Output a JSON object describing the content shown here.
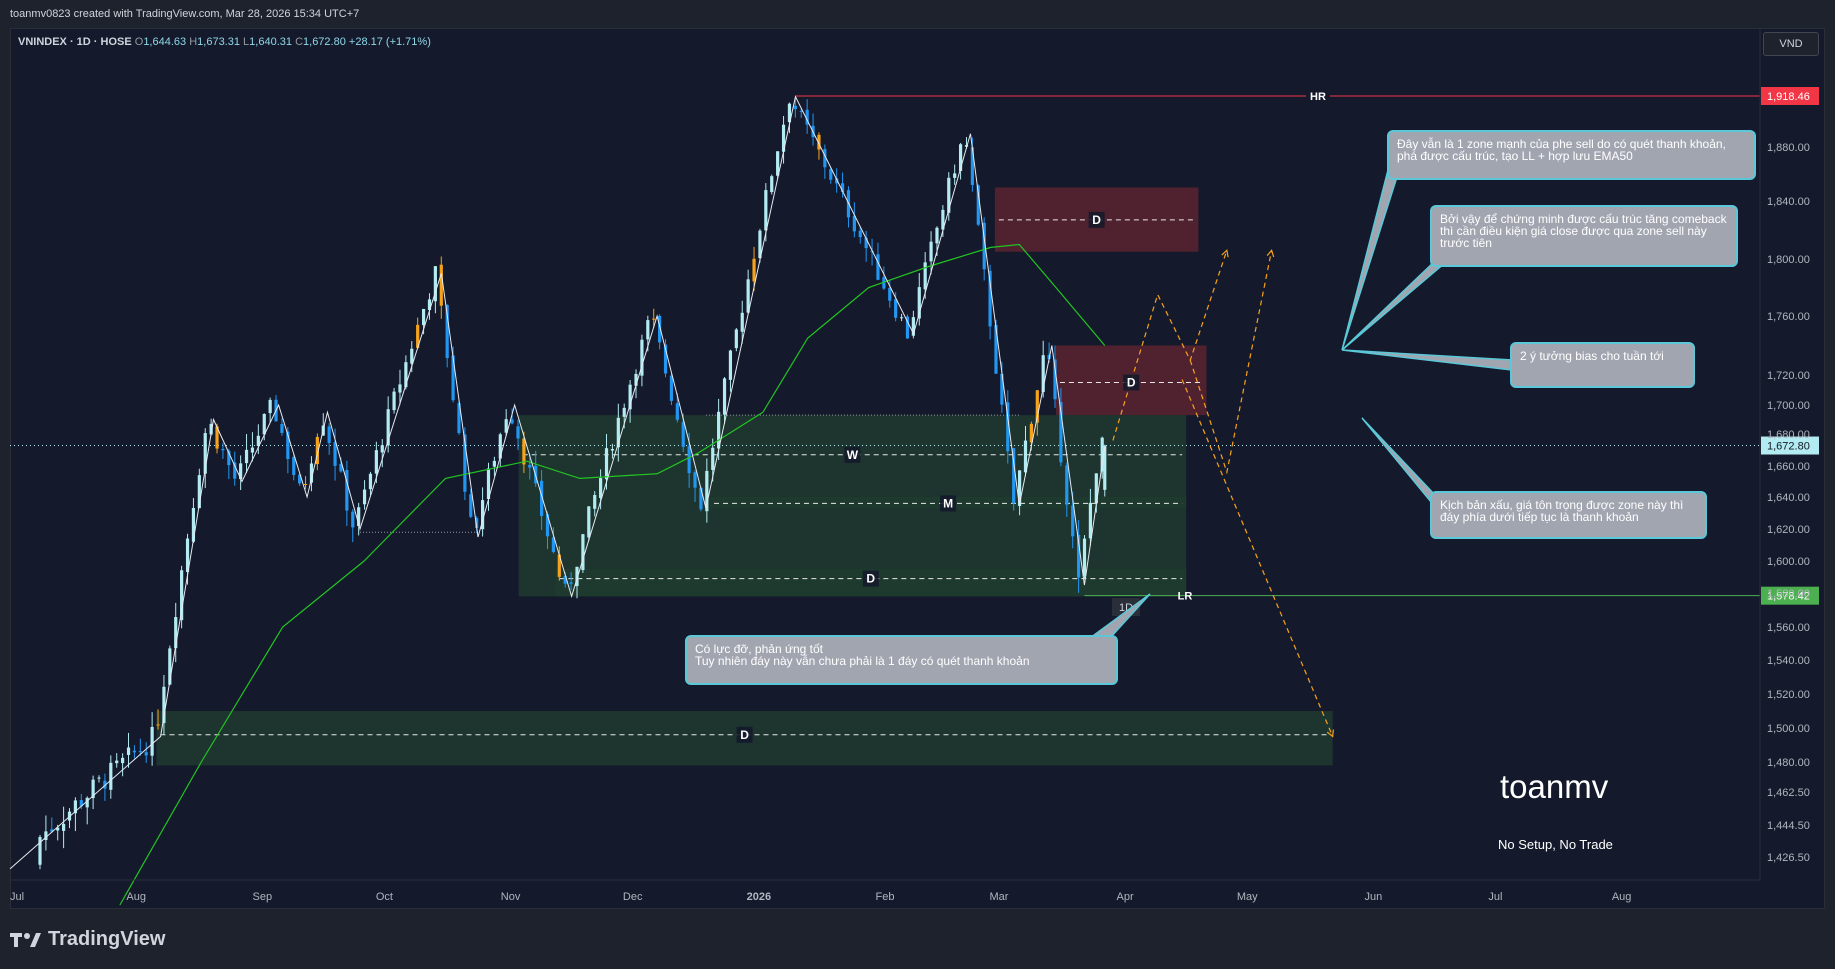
{
  "header": {
    "credit": "toanmv0823 created with TradingView.com, Mar 28, 2026 15:34 UTC+7"
  },
  "legend": {
    "symbol": "VNINDEX · 1D · HOSE",
    "o_label": "O",
    "o": "1,644.63",
    "h_label": "H",
    "h": "1,673.31",
    "l_label": "L",
    "l": "1,640.31",
    "c_label": "C",
    "c": "1,672.80",
    "change": "+28.17 (+1.71%)"
  },
  "currency_button": "VND",
  "branding": {
    "name": "TradingView"
  },
  "watermark": {
    "name": "toanmv",
    "tagline": "No Setup, No Trade"
  },
  "colors": {
    "background": "#141a2b",
    "candle_up": "#b2ebf2",
    "candle_down": "#2196f3",
    "candle_inside": "#f7a21b",
    "ema": "#22c522",
    "supply_zone": "#5a2330",
    "demand_zone": "#1f3b2f",
    "hr_line": "#f23645",
    "lr_line": "#4caf50",
    "callout_bg": "#a1a5b0",
    "callout_border": "#5ac8d8",
    "projection": "#f7a21b"
  },
  "annotations": {
    "hr_label": "HR",
    "lr_label": "LR",
    "tf_badge": "1D",
    "zone_d": "D",
    "zone_w": "W",
    "zone_m": "M",
    "callout_support": "Có lực đỡ, phản ứng tốt\nTuy nhiên đáy này vẫn chưa phải là 1 đáy có quét thanh khoản",
    "callout_sell_zone": "Đây vẫn là 1 zone mạnh của phe sell do có quét thanh khoản, phá được cấu trúc, tạo LL + hợp lưu EMA50",
    "callout_structure": "Bởi vậy để chứng minh được cấu trúc tăng comeback thì cần điều kiện giá close được qua zone sell này trước tiên",
    "callout_bias": "2 ý tưởng bias cho tuần tới",
    "callout_bearish": "Kịch bản xấu, giá tôn trọng được zone này thì đáy phía dưới tiếp tục là thanh khoản"
  },
  "chart_data": {
    "type": "candlestick",
    "symbol": "VNINDEX",
    "timeframe": "1D",
    "exchange": "HOSE",
    "y_ticks": [
      "1,880.00",
      "1,840.00",
      "1,800.00",
      "1,760.00",
      "1,720.00",
      "1,700.00",
      "1,680.00",
      "1,660.00",
      "1,640.00",
      "1,620.00",
      "1,600.00",
      "1,580.00",
      "1,560.00",
      "1,540.00",
      "1,520.00",
      "1,500.00",
      "1,480.00",
      "1,462.50",
      "1,444.50",
      "1,426.50"
    ],
    "x_ticks": [
      "Jul",
      "Aug",
      "Sep",
      "Oct",
      "Nov",
      "Dec",
      "2026",
      "Feb",
      "Mar",
      "Apr",
      "May",
      "Jun",
      "Jul",
      "Aug"
    ],
    "last_price": "1,672.80",
    "price_labels": {
      "hr": "1,918.46",
      "lr": "1,578.42"
    },
    "swing_path": [
      [
        "2025-07-01",
        1420
      ],
      [
        "2025-08-07",
        1495
      ],
      [
        "2025-08-20",
        1690
      ],
      [
        "2025-08-27",
        1650
      ],
      [
        "2025-09-05",
        1700
      ],
      [
        "2025-09-12",
        1640
      ],
      [
        "2025-09-17",
        1695
      ],
      [
        "2025-09-25",
        1620
      ],
      [
        "2025-10-15",
        1790
      ],
      [
        "2025-10-24",
        1615
      ],
      [
        "2025-11-02",
        1700
      ],
      [
        "2025-11-16",
        1578
      ],
      [
        "2025-12-07",
        1760
      ],
      [
        "2025-12-19",
        1633
      ],
      [
        "2026-01-10",
        1918
      ],
      [
        "2026-02-08",
        1748
      ],
      [
        "2026-02-22",
        1890
      ],
      [
        "2026-03-06",
        1635
      ],
      [
        "2026-03-14",
        1740
      ],
      [
        "2026-03-22",
        1585
      ],
      [
        "2026-03-27",
        1672
      ]
    ],
    "ema50": [
      [
        "2025-07-28",
        1400
      ],
      [
        "2025-08-17",
        1480
      ],
      [
        "2025-09-06",
        1560
      ],
      [
        "2025-09-26",
        1600
      ],
      [
        "2025-10-16",
        1652
      ],
      [
        "2025-11-05",
        1663
      ],
      [
        "2025-11-18",
        1652
      ],
      [
        "2025-12-07",
        1655
      ],
      [
        "2025-12-17",
        1668
      ],
      [
        "2026-01-02",
        1695
      ],
      [
        "2026-01-13",
        1745
      ],
      [
        "2026-01-28",
        1780
      ],
      [
        "2026-02-12",
        1795
      ],
      [
        "2026-02-27",
        1808
      ],
      [
        "2026-03-06",
        1810
      ],
      [
        "2026-03-15",
        1780
      ],
      [
        "2026-03-27",
        1740
      ]
    ],
    "zones": [
      {
        "type": "supply",
        "label": "D",
        "start": "2026-02-28",
        "end": "2026-04-19",
        "top": 1850,
        "bottom": 1805,
        "mid": 1827
      },
      {
        "type": "supply",
        "label": "D",
        "start": "2026-03-15",
        "end": "2026-04-21",
        "top": 1740,
        "bottom": 1693,
        "mid": 1715
      },
      {
        "type": "demand",
        "label": "W",
        "start": "2025-11-03",
        "end": "2026-04-16",
        "top": 1693,
        "bottom": 1578,
        "mid": 1667
      },
      {
        "type": "demand",
        "label": "M",
        "start": "2025-12-20",
        "end": "2026-04-16",
        "top": 1640,
        "bottom": 1633,
        "mid": 1636
      },
      {
        "type": "demand",
        "label": "D",
        "start": "2025-11-12",
        "end": "2026-04-16",
        "top": 1595,
        "bottom": 1578,
        "mid": 1589
      },
      {
        "type": "demand",
        "label": "D",
        "start": "2025-08-06",
        "end": "2026-05-22",
        "top": 1510,
        "bottom": 1478,
        "mid": 1496
      }
    ],
    "levels": {
      "hr": 1918.46,
      "lr": 1578.42,
      "last": 1672.8
    },
    "projections": [
      {
        "name": "bullish",
        "points": [
          [
            "2026-03-29",
            1676
          ],
          [
            "2026-04-09",
            1775
          ],
          [
            "2026-04-17",
            1730
          ],
          [
            "2026-04-26",
            1806
          ]
        ]
      },
      {
        "name": "alt",
        "points": [
          [
            "2026-04-17",
            1730
          ],
          [
            "2026-04-26",
            1656
          ],
          [
            "2026-05-07",
            1806
          ]
        ]
      },
      {
        "name": "bearish",
        "points": [
          [
            "2026-04-15",
            1717
          ],
          [
            "2026-05-22",
            1495
          ]
        ]
      }
    ]
  }
}
